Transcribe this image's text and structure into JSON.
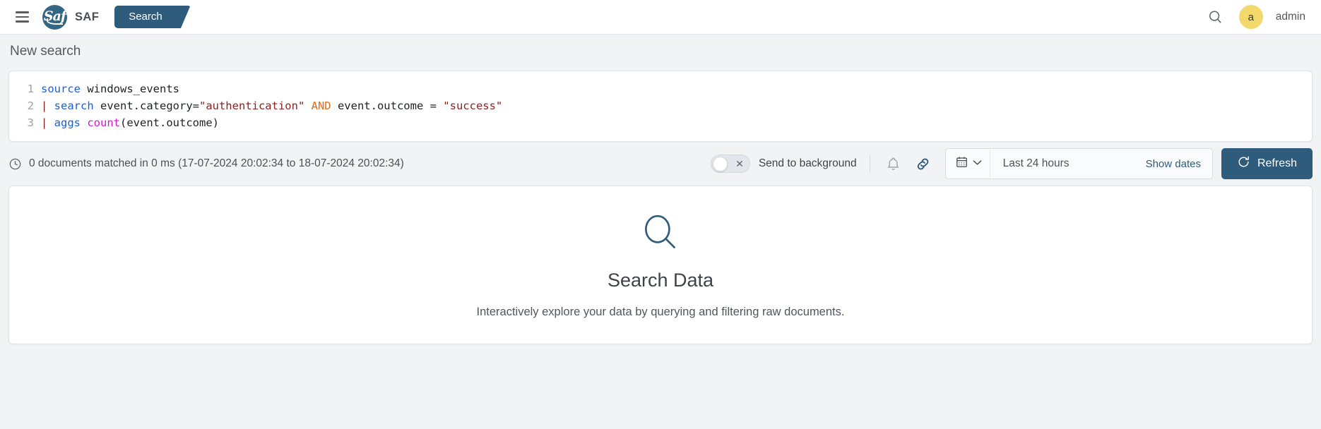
{
  "header": {
    "menu_label": "Menu",
    "brand_name": "SAF",
    "logo_mark": "Saf",
    "tabs": [
      {
        "label": "Search",
        "active": true
      }
    ],
    "search_icon": "search-icon",
    "avatar_initial": "a",
    "username": "admin"
  },
  "page": {
    "title": "New search"
  },
  "editor": {
    "lines": [
      {
        "number": "1",
        "tokens": [
          {
            "text": "source",
            "type": "kw"
          },
          {
            "text": " windows_events",
            "type": "plain"
          }
        ]
      },
      {
        "number": "2",
        "tokens": [
          {
            "text": "| ",
            "type": "pipe"
          },
          {
            "text": "search",
            "type": "kw"
          },
          {
            "text": " event.category=",
            "type": "plain"
          },
          {
            "text": "\"authentication\"",
            "type": "str"
          },
          {
            "text": " ",
            "type": "plain"
          },
          {
            "text": "AND",
            "type": "op"
          },
          {
            "text": " event.outcome = ",
            "type": "plain"
          },
          {
            "text": "\"success\"",
            "type": "str"
          }
        ]
      },
      {
        "number": "3",
        "tokens": [
          {
            "text": "| ",
            "type": "pipe"
          },
          {
            "text": "aggs ",
            "type": "kw"
          },
          {
            "text": "count",
            "type": "fn"
          },
          {
            "text": "(event.outcome)",
            "type": "plain"
          }
        ]
      }
    ]
  },
  "status": {
    "clock_icon": "clock-icon",
    "summary": "0 documents matched in 0 ms (17-07-2024 20:02:34 to 18-07-2024 20:02:34)",
    "send_to_background_label": "Send to background",
    "send_to_background_state": "off",
    "toggle_off_glyph": "✕",
    "alert_icon": "bell-icon",
    "link_icon": "link-icon"
  },
  "datepicker": {
    "calendar_icon": "calendar-icon",
    "chevron_icon": "chevron-down-icon",
    "value": "Last 24 hours",
    "show_dates_label": "Show dates"
  },
  "refresh": {
    "icon": "refresh-icon",
    "label": "Refresh"
  },
  "empty_state": {
    "icon": "magnifier-icon",
    "title": "Search Data",
    "description": "Interactively explore your data by querying and filtering raw documents."
  },
  "colors": {
    "accent_dark_blue": "#2f5b7c",
    "logo_blue": "#336584",
    "avatar_yellow": "#f3d96b",
    "page_bg": "#f1f3f5",
    "panel_bg": "#ffffff",
    "keyword": "#1a5fdd",
    "string": "#8f2020",
    "operator": "#e06c14",
    "function": "#d416d4"
  }
}
